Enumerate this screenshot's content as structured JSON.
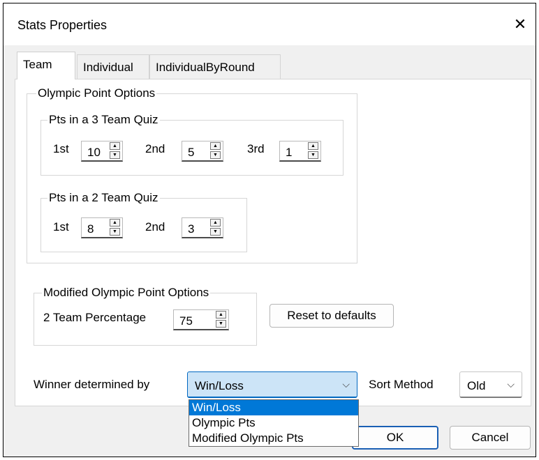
{
  "dialog": {
    "title": "Stats Properties",
    "close_glyph": "✕"
  },
  "tabs": [
    {
      "label": "Team",
      "active": true
    },
    {
      "label": "Individual",
      "active": false
    },
    {
      "label": "IndividualByRound",
      "active": false
    }
  ],
  "olympic": {
    "legend": "Olympic Point Options",
    "three_team": {
      "legend": "Pts in a 3 Team Quiz",
      "first_label": "1st",
      "first_value": "10",
      "second_label": "2nd",
      "second_value": "5",
      "third_label": "3rd",
      "third_value": "1"
    },
    "two_team": {
      "legend": "Pts in a 2 Team Quiz",
      "first_label": "1st",
      "first_value": "8",
      "second_label": "2nd",
      "second_value": "3"
    }
  },
  "modified": {
    "legend": "Modified Olympic Point Options",
    "percentage_label": "2 Team Percentage",
    "percentage_value": "75",
    "reset_label": "Reset to defaults"
  },
  "winner": {
    "label": "Winner determined by",
    "selected": "Win/Loss",
    "options": [
      "Win/Loss",
      "Olympic Pts",
      "Modified Olympic Pts"
    ]
  },
  "sort": {
    "label": "Sort Method",
    "selected": "Old"
  },
  "footer": {
    "ok_label": "OK",
    "cancel_label": "Cancel"
  },
  "icons": {
    "spin_up": "▲",
    "spin_down": "▼",
    "chevron": "⌵"
  }
}
